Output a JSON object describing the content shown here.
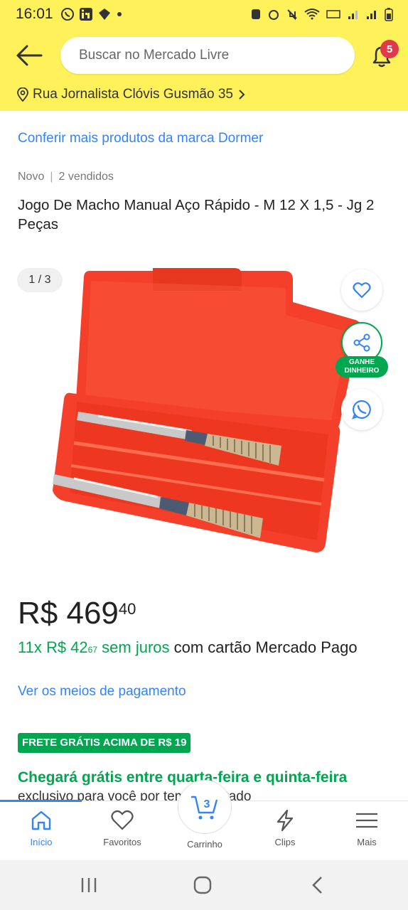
{
  "status_bar": {
    "time": "16:01"
  },
  "header": {
    "search_placeholder": "Buscar no Mercado Livre",
    "notifications_count": "5",
    "address": "Rua Jornalista Clóvis Gusmão 35"
  },
  "product": {
    "brand_link": "Conferir mais produtos da marca Dormer",
    "condition": "Novo",
    "sold": "2 vendidos",
    "title": "Jogo De Macho Manual Aço Rápido - M 12 X 1,5 - Jg 2 Peças",
    "gallery_counter": "1 / 3",
    "earn_badge": "GANHE DINHEIRO",
    "price_currency": "R$",
    "price_main": "469",
    "price_cents": "40",
    "installment_count": "11x R$ 42",
    "installment_cents": "67",
    "installment_interest": "sem juros",
    "installment_card": "com cartão Mercado Pago",
    "payment_link": "Ver os meios de pagamento",
    "free_shipping_badge": "FRETE GRÁTIS ACIMA DE R$ 19",
    "delivery": "Chegará grátis entre quarta-feira e quinta-feira",
    "delivery_sub": "exclusivo para você por tempo limitado"
  },
  "bottom_nav": {
    "items": [
      {
        "label": "Início",
        "icon": "home-icon",
        "active": true
      },
      {
        "label": "Favoritos",
        "icon": "heart-icon"
      },
      {
        "label": "Carrinho",
        "icon": "cart-icon",
        "count": "3"
      },
      {
        "label": "Clips",
        "icon": "clips-icon"
      },
      {
        "label": "Mais",
        "icon": "menu-icon"
      }
    ]
  },
  "colors": {
    "brand_yellow": "#fff159",
    "link_blue": "#3483fa",
    "green": "#00a650",
    "badge_red": "#e0394a",
    "product_red": "#f4402a"
  }
}
